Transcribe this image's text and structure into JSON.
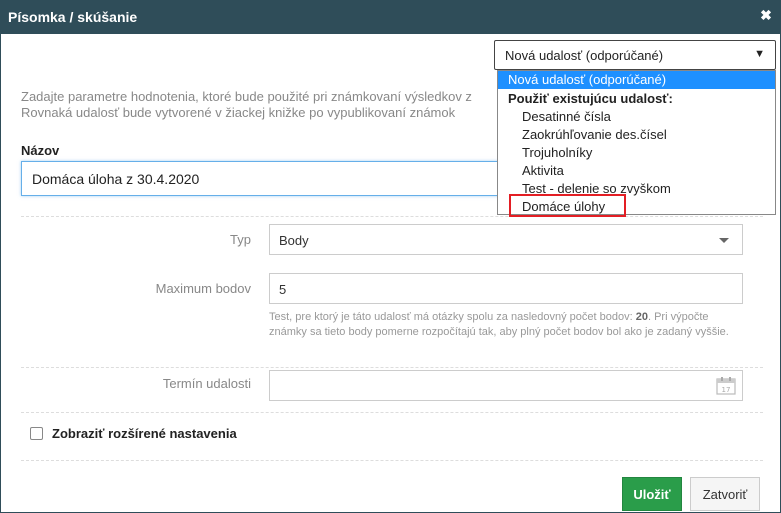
{
  "dialog": {
    "title": "Písomka / skúšanie",
    "close_glyph": "✖"
  },
  "intro": {
    "line1": "Zadajte parametre hodnotenia, ktoré bude použité pri známkovaní výsledkov z",
    "line2": "Rovnaká udalosť bude vytvorené v žiackej knižke po vypublikovaní známok"
  },
  "nazov": {
    "label": "Názov",
    "value": "Domáca úloha z 30.4.2020"
  },
  "typ": {
    "label": "Typ",
    "value": "Body"
  },
  "max_bodov": {
    "label": "Maximum bodov",
    "value": "5",
    "help_part1": "Test, pre ktorý je táto udalosť má otázky spolu za nasledovný počet bodov: ",
    "help_points": "20",
    "help_part2": ". Pri výpočte známky sa tieto body pomerne rozpočítajú tak, aby plný počet bodov bol ako je zadaný vyššie."
  },
  "termin": {
    "label": "Termín udalosti",
    "value": "",
    "icon": "calendar-icon",
    "icon_day": "17"
  },
  "advanced": {
    "label": "Zobraziť rozšírené nastavenia",
    "checked": false
  },
  "buttons": {
    "save": "Uložiť",
    "close": "Zatvoriť"
  },
  "event_select": {
    "selected": "Nová udalosť (odporúčané)",
    "arrow": "▼",
    "options": [
      "Nová udalosť (odporúčané)"
    ],
    "group_label": "Použiť existujúcu udalosť:",
    "existing": [
      "Desatinné čísla",
      "Zaokrúhľovanie des.čísel",
      "Trojuholníky",
      "Aktivita",
      "Test - delenie so zvyškom",
      "Domáce úlohy"
    ],
    "highlighted": "Domáce úlohy"
  },
  "colors": {
    "titlebar": "#2f4d59",
    "save_button": "#2a9d4a",
    "dropdown_selected": "#1e90ff",
    "highlight": "#e31e24"
  }
}
